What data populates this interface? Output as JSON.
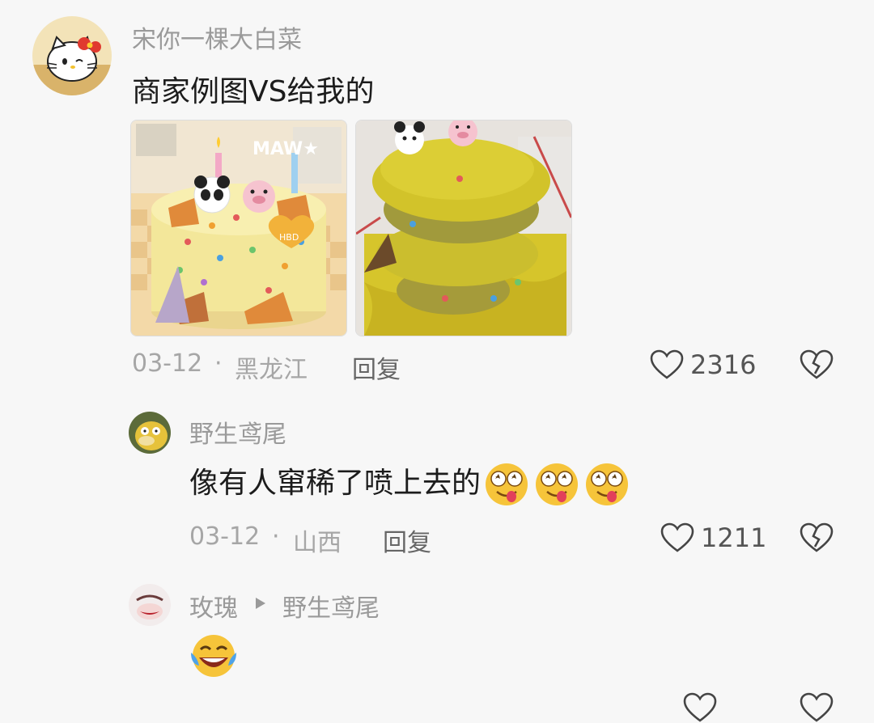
{
  "comments": [
    {
      "username": "宋你一棵大白菜",
      "text": "商家例图VS给我的",
      "date": "03-12",
      "separator": "·",
      "location": "黑龙江",
      "reply_label": "回复",
      "like_count": "2316",
      "images": [
        "merchant-example-cake",
        "received-cake"
      ],
      "image_overlay_text": "MAW★",
      "cake_sign_text": "HBD"
    },
    {
      "username": "野生鸢尾",
      "text": "像有人窜稀了喷上去的",
      "emoji_name": "dizzy-tongue-face-emoji",
      "emoji_count": 3,
      "date": "03-12",
      "separator": "·",
      "location": "山西",
      "reply_label": "回复",
      "like_count": "1211"
    },
    {
      "username": "玫瑰",
      "reply_to": "野生鸢尾",
      "emoji_name": "laughing-tears-emoji"
    }
  ],
  "colors": {
    "background": "#f7f7f7",
    "username": "#9a9a9a",
    "text": "#1c1c1c",
    "meta": "#a6a6a6"
  }
}
